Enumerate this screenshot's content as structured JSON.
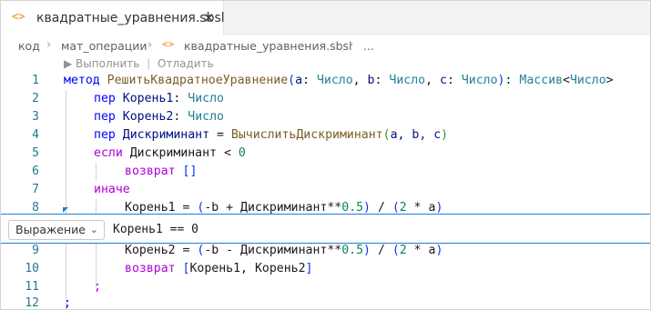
{
  "tab": {
    "icon": "<>",
    "title": "квадратные_уравнения.sbsl",
    "close": "✕"
  },
  "breadcrumb": {
    "items": [
      "код",
      "мат_операции",
      "квадратные_уравнения.sbsl",
      "..."
    ],
    "separator": "›",
    "file_icon": "<>"
  },
  "codelens": {
    "run": "▶ Выполнить",
    "divider": "|",
    "debug": "Отладить"
  },
  "lines": [
    {
      "n": "1"
    },
    {
      "n": "2"
    },
    {
      "n": "3"
    },
    {
      "n": "4"
    },
    {
      "n": "5"
    },
    {
      "n": "6"
    },
    {
      "n": "7"
    },
    {
      "n": "8"
    },
    {
      "n": "9"
    },
    {
      "n": "10"
    },
    {
      "n": "11"
    },
    {
      "n": "12"
    }
  ],
  "code": {
    "l1": {
      "kw": "метод",
      "fn": "РешитьКвадратноеУравнение",
      "p1": "(",
      "a": "a",
      "c1": ": ",
      "t1": "Число",
      "s1": ", ",
      "b": "b",
      "c2": ": ",
      "t2": "Число",
      "s2": ", ",
      "c": "c",
      "c3": ": ",
      "t3": "Число",
      "p2": ")",
      "c4": ": ",
      "t4": "Массив",
      "lt": "<",
      "t5": "Число",
      "gt": ">"
    },
    "l2": {
      "kw": "пер",
      "id": "Корень1",
      "c": ": ",
      "t": "Число"
    },
    "l3": {
      "kw": "пер",
      "id": "Корень2",
      "c": ": ",
      "t": "Число"
    },
    "l4": {
      "kw": "пер",
      "id": "Дискриминант",
      "eq": " = ",
      "fn": "ВычислитьДискриминант",
      "p1": "(",
      "args": "a, b, c",
      "p2": ")"
    },
    "l5": {
      "kw": "если",
      "id": "Дискриминант",
      "op": " < ",
      "num": "0"
    },
    "l6": {
      "kw": "возврат",
      "br": "[]"
    },
    "l7": {
      "kw": "иначе"
    },
    "l8": {
      "id": "Корень1",
      "eq": " = ",
      "p1": "(",
      "expr1": "-b + Дискриминант**",
      "num1": "0.5",
      "p2": ")",
      "div": " / ",
      "p3": "(",
      "num2": "2",
      "expr2": " * a",
      "p4": ")"
    },
    "l9": {
      "id": "Корень2",
      "eq": " = ",
      "p1": "(",
      "expr1": "-b - Дискриминант**",
      "num1": "0.5",
      "p2": ")",
      "div": " / ",
      "p3": "(",
      "num2": "2",
      "expr2": " * a",
      "p4": ")"
    },
    "l10": {
      "kw": "возврат",
      "b1": "[",
      "items": "Корень1, Корень2",
      "b2": "]"
    },
    "l11": {
      "semi": ";"
    },
    "l12": {
      "semi": ";"
    }
  },
  "expression_bar": {
    "select_label": "Выражение",
    "chevron": "⌄",
    "expression": "Корень1 == 0"
  },
  "colors": {
    "accent": "#1f7ed0",
    "line_numbers": "#237893",
    "keyword": "#af00db",
    "type": "#267f99",
    "function": "#795e26",
    "number": "#098658",
    "tab_icon": "#e9a23b"
  }
}
